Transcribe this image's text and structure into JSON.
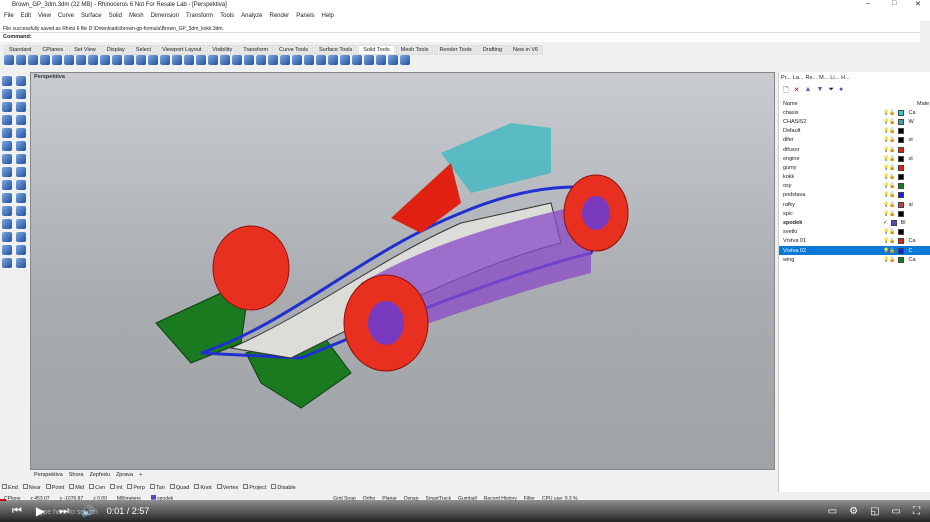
{
  "title": "Brown_GP_3dm.3dm (22 MB) - Rhinoceros 6 Not For Resale Lab - [Perspektiva]",
  "menu": [
    "File",
    "Edit",
    "View",
    "Curve",
    "Surface",
    "Solid",
    "Mesh",
    "Dimension",
    "Transform",
    "Tools",
    "Analyze",
    "Render",
    "Panels",
    "Help"
  ],
  "command_history": "File successfully saved as Rhino 6 file D:\\Downloads\\brown-gp-formula\\Brown_GP_3dm_kokk.3dm.",
  "command_label": "Command:",
  "toolbar_tabs": [
    "Standard",
    "CPlanes",
    "Set View",
    "Display",
    "Select",
    "Viewport Layout",
    "Visibility",
    "Transform",
    "Curve Tools",
    "Surface Tools",
    "Solid Tools",
    "Mesh Tools",
    "Render Tools",
    "Drafting",
    "New in V6"
  ],
  "active_tab": "Solid Tools",
  "viewport_label": "Perspektiva",
  "panel_tabs": [
    "Pr...",
    "La...",
    "Re...",
    "M...",
    "Li...",
    "H..."
  ],
  "layers_header": {
    "name": "Name",
    "material": "Mate"
  },
  "layers": [
    {
      "name": "chasis",
      "color": "#22c8e0",
      "mat": "Ca"
    },
    {
      "name": "CHASIS2",
      "color": "#40a0b0",
      "mat": "W"
    },
    {
      "name": "Default",
      "color": "#000000",
      "mat": ""
    },
    {
      "name": "difer",
      "color": "#000000",
      "mat": "st"
    },
    {
      "name": "difusor",
      "color": "#e02010",
      "mat": ""
    },
    {
      "name": "engine",
      "color": "#000000",
      "mat": "st"
    },
    {
      "name": "gumy",
      "color": "#e02010",
      "mat": ""
    },
    {
      "name": "kokk",
      "color": "#000000",
      "mat": ""
    },
    {
      "name": "osy",
      "color": "#108020",
      "mat": ""
    },
    {
      "name": "podstava",
      "color": "#1020e0",
      "mat": ""
    },
    {
      "name": "rafky",
      "color": "#c04040",
      "mat": "al"
    },
    {
      "name": "spic",
      "color": "#000000",
      "mat": ""
    },
    {
      "name": "spodek",
      "color": "#6040c0",
      "mat": "Bl",
      "current": true
    },
    {
      "name": "svetlo",
      "color": "#000000",
      "mat": ""
    },
    {
      "name": "Vrstva 01",
      "color": "#e02010",
      "mat": "Ca"
    },
    {
      "name": "Vrstva 02",
      "color": "#1020e0",
      "mat": "C",
      "selected": true
    },
    {
      "name": "wing",
      "color": "#108020",
      "mat": "Ca"
    }
  ],
  "viewport_tabs": [
    "Perspektiva",
    "Shora",
    "Zepředu",
    "Zprava",
    "+"
  ],
  "osnaps": [
    "End",
    "Near",
    "Point",
    "Mid",
    "Cen",
    "Int",
    "Perp",
    "Tan",
    "Quad",
    "Knot",
    "Vertex",
    "Project",
    "Disable"
  ],
  "status": {
    "cplane": "CPlane",
    "x": "x 453.07",
    "y": "y -1076.87",
    "z": "z 0.00",
    "units": "Millimeters",
    "layer": "spodek",
    "items": [
      "Grid Snap",
      "Ortho",
      "Planar",
      "Osnap",
      "SmartTrack",
      "Gumball",
      "Record History",
      "Filter",
      "CPU use: 0.3 %"
    ]
  },
  "video": {
    "time": "0:01 / 2:57",
    "progress": 0.006,
    "search": "Type here to search"
  }
}
